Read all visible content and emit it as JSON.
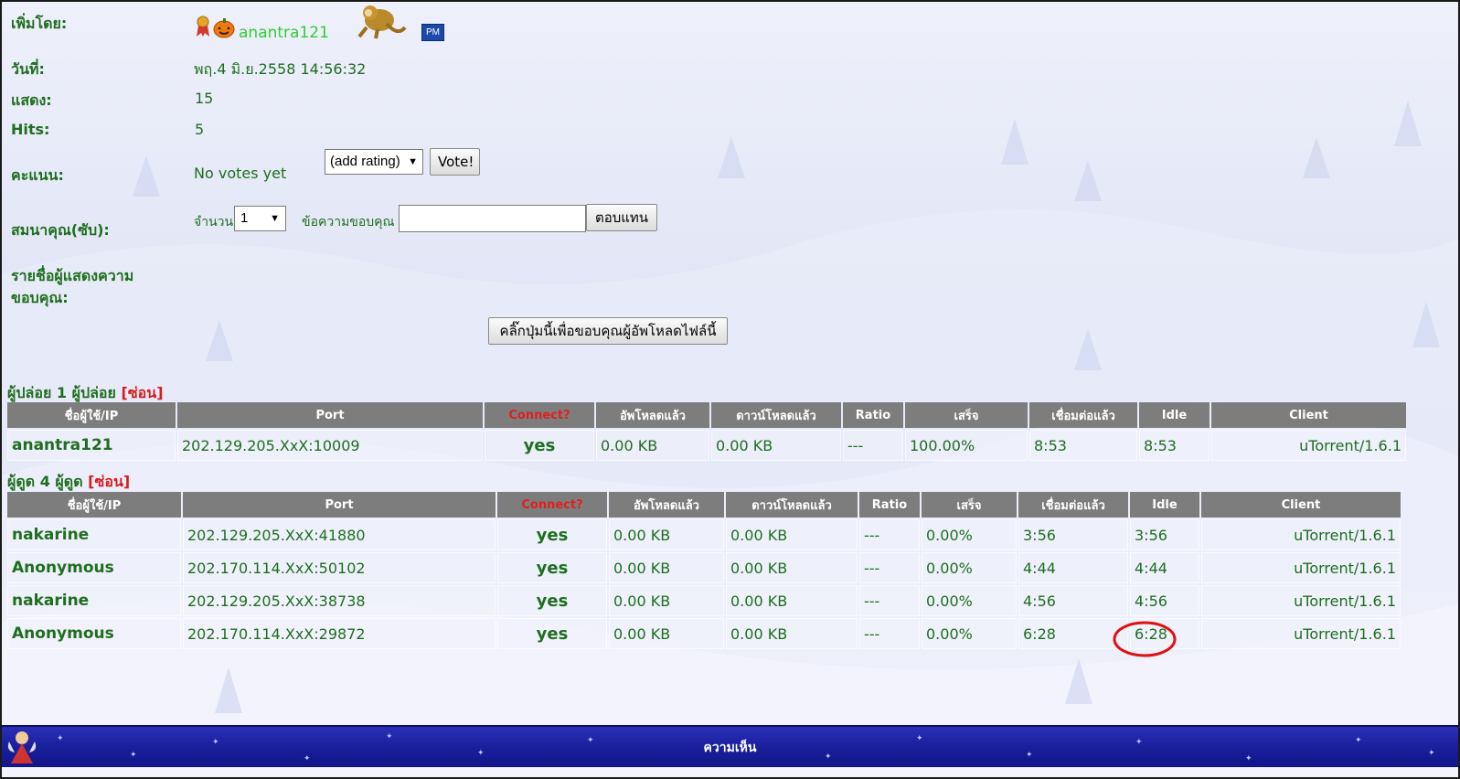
{
  "info": {
    "uploader_label": "เพิ่มโดย:",
    "uploader_name": "anantra121",
    "pm_label": "PM",
    "date_label": "วันที่:",
    "date_value": "พฤ.4 มิ.ย.2558 14:56:32",
    "views_label": "แสดง:",
    "views_value": "15",
    "hits_label": "Hits:",
    "hits_value": "5",
    "rating_label": "คะแนน:",
    "rating_value": "No votes yet",
    "rating_select": "(add rating)",
    "vote_button": "Vote!",
    "thanks_label": "สมนาคุณ(ซับ):",
    "amount_label": "จำนวน",
    "amount_select": "1",
    "message_label": "ข้อความขอบคุณ",
    "reply_button": "ตอบแทน",
    "thanks_list_label_1": "รายชื่อผู้แสดงความ",
    "thanks_list_label_2": "ขอบคุณ:",
    "thank_uploader_button": "คลิ๊กปุ่มนี้เพื่อขอบคุณผู้อัพโหลดไฟล์นี้"
  },
  "seeders": {
    "title": "ผู้ปล่อย 1 ผู้ปล่อย",
    "hide": "[ซ่อน]",
    "columns": [
      "ชื่อผู้ใช้/IP",
      "Port",
      "Connect?",
      "อัพโหลดแล้ว",
      "ดาวน์โหลดแล้ว",
      "Ratio",
      "เสร็จ",
      "เชื่อมต่อแล้ว",
      "Idle",
      "Client"
    ],
    "rows": [
      {
        "user": "anantra121",
        "port": "202.129.205.XxX:10009",
        "connect": "yes",
        "up": "0.00 KB",
        "down": "0.00 KB",
        "ratio": "---",
        "done": "100.00%",
        "connected": "8:53",
        "idle": "8:53",
        "client": "uTorrent/1.6.1"
      }
    ]
  },
  "leechers": {
    "title": "ผู้ดูด 4 ผู้ดูด",
    "hide": "[ซ่อน]",
    "columns": [
      "ชื่อผู้ใช้/IP",
      "Port",
      "Connect?",
      "อัพโหลดแล้ว",
      "ดาวน์โหลดแล้ว",
      "Ratio",
      "เสร็จ",
      "เชื่อมต่อแล้ว",
      "Idle",
      "Client"
    ],
    "rows": [
      {
        "user": "nakarine",
        "port": "202.129.205.XxX:41880",
        "connect": "yes",
        "up": "0.00 KB",
        "down": "0.00 KB",
        "ratio": "---",
        "done": "0.00%",
        "connected": "3:56",
        "idle": "3:56",
        "client": "uTorrent/1.6.1"
      },
      {
        "user": "Anonymous",
        "port": "202.170.114.XxX:50102",
        "connect": "yes",
        "up": "0.00 KB",
        "down": "0.00 KB",
        "ratio": "---",
        "done": "0.00%",
        "connected": "4:44",
        "idle": "4:44",
        "client": "uTorrent/1.6.1"
      },
      {
        "user": "nakarine",
        "port": "202.129.205.XxX:38738",
        "connect": "yes",
        "up": "0.00 KB",
        "down": "0.00 KB",
        "ratio": "---",
        "done": "0.00%",
        "connected": "4:56",
        "idle": "4:56",
        "client": "uTorrent/1.6.1"
      },
      {
        "user": "Anonymous",
        "port": "202.170.114.XxX:29872",
        "connect": "yes",
        "up": "0.00 KB",
        "down": "0.00 KB",
        "ratio": "---",
        "done": "0.00%",
        "connected": "6:28",
        "idle": "6:28",
        "client": "uTorrent/1.6.1"
      }
    ]
  },
  "footer": {
    "title": "ความเห็น"
  },
  "colors": {
    "label_green": "#1f6e1f",
    "user_green": "#55dd66",
    "user_red": "#dd1111",
    "header_gray": "#7d7d7d",
    "footer_blue": "#1a1f9c",
    "highlight_circle": "#e01010"
  },
  "icons": [
    "award-ribbon-icon",
    "pumpkin-icon",
    "monkey-avatar-icon",
    "pm-icon",
    "dropdown-arrow-icon"
  ]
}
